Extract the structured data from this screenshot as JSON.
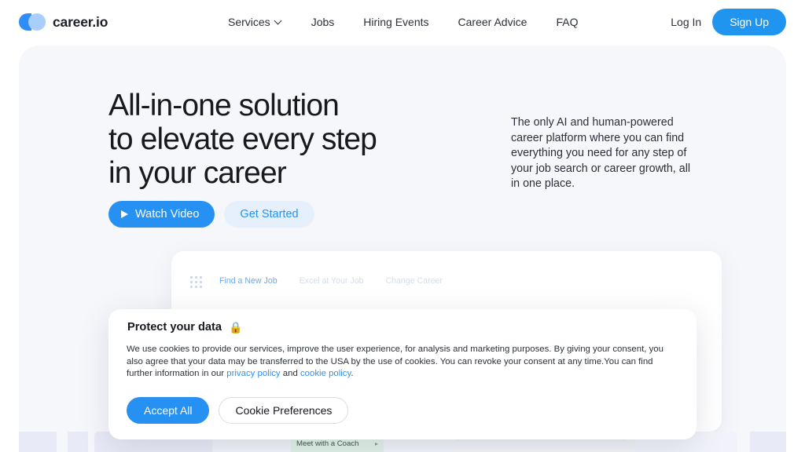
{
  "header": {
    "brand": "career.io",
    "logo_icon": "career-logo-icon",
    "nav": [
      {
        "label": "Services",
        "has_dropdown": true,
        "icon": "chevron-down-icon"
      },
      {
        "label": "Jobs",
        "has_dropdown": false
      },
      {
        "label": "Hiring Events",
        "has_dropdown": false
      },
      {
        "label": "Career Advice",
        "has_dropdown": false
      },
      {
        "label": "FAQ",
        "has_dropdown": false
      }
    ],
    "login_label": "Log In",
    "signup_label": "Sign Up"
  },
  "hero": {
    "heading_line1": "All-in-one solution",
    "heading_line2": "to elevate every step",
    "heading_line3": "in your career",
    "lede": "The only AI and human-powered career platform where you can find everything you need for any step of your job search or career growth, all in one place.",
    "watch_video_label": "Watch Video",
    "watch_video_icon": "play-icon",
    "get_started_label": "Get Started"
  },
  "product_mock": {
    "grid_icon": "app-grid-icon",
    "tabs": [
      {
        "label": "Find a New Job",
        "active": true
      },
      {
        "label": "Excel at Your Job",
        "active": false
      },
      {
        "label": "Change Career",
        "active": false
      }
    ],
    "coach_pill_label": "Meet with a Coach",
    "coach_pill_icon": "chevron-right-icon",
    "illustration": "jumping-person-line-art",
    "arrow": "curved-upward-arrow"
  },
  "cookie_banner": {
    "title": "Protect your data",
    "lock_icon": "lock-icon",
    "body_part1": "We use cookies to provide our services, improve the user experience, for analysis and marketing purposes. By giving your consent, you also agree that your data may be transferred to the USA by the use of cookies. You can revoke your consent at any time.You can find further information in our ",
    "privacy_link": "privacy policy",
    "body_conjunction": " and ",
    "cookie_link": "cookie policy",
    "body_end": ".",
    "accept_label": "Accept All",
    "preferences_label": "Cookie Preferences"
  },
  "colors": {
    "accent_blue": "#2691f3",
    "logo_blue": "#2f8dfa",
    "logo_light_blue": "#a8cefb",
    "hero_background": "#f6f7fb",
    "link_blue": "#2e92f2",
    "lavender_card": "#e5e7f8",
    "peach_card": "#fbe0d6",
    "green_pill": "#e2f1e8",
    "text_dark": "#17191f"
  }
}
